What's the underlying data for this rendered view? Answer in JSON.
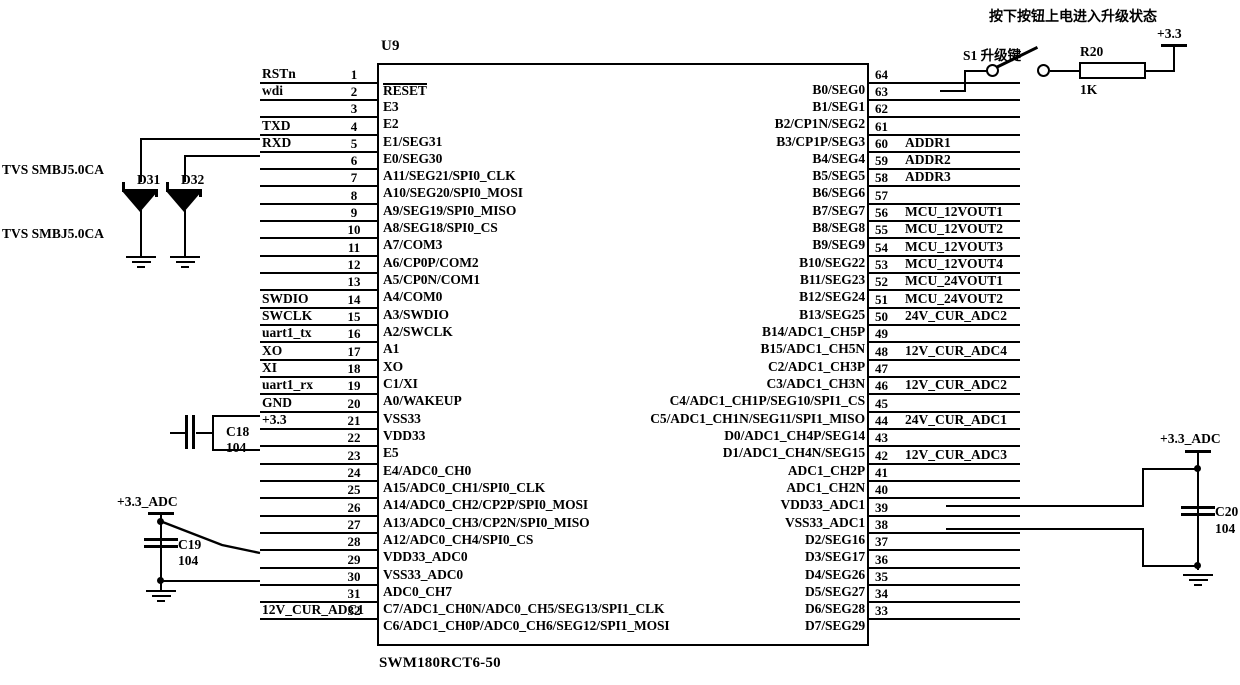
{
  "title_note": "按下按钮上电进入升级状态",
  "ic": {
    "ref": "U9",
    "part": "SWM180RCT6-50",
    "left_pins": [
      {
        "num": "1",
        "name": "RESET",
        "overline": true,
        "net": "RSTn"
      },
      {
        "num": "2",
        "name": "E3",
        "overline": false,
        "net": "wdi"
      },
      {
        "num": "3",
        "name": "E2",
        "overline": false,
        "net": ""
      },
      {
        "num": "4",
        "name": "E1/SEG31",
        "overline": false,
        "net": "TXD"
      },
      {
        "num": "5",
        "name": "E0/SEG30",
        "overline": false,
        "net": "RXD"
      },
      {
        "num": "6",
        "name": "A11/SEG21/SPI0_CLK",
        "overline": false,
        "net": ""
      },
      {
        "num": "7",
        "name": "A10/SEG20/SPI0_MOSI",
        "overline": false,
        "net": ""
      },
      {
        "num": "8",
        "name": "A9/SEG19/SPI0_MISO",
        "overline": false,
        "net": ""
      },
      {
        "num": "9",
        "name": "A8/SEG18/SPI0_CS",
        "overline": false,
        "net": ""
      },
      {
        "num": "10",
        "name": "A7/COM3",
        "overline": false,
        "net": ""
      },
      {
        "num": "11",
        "name": "A6/CP0P/COM2",
        "overline": false,
        "net": ""
      },
      {
        "num": "12",
        "name": "A5/CP0N/COM1",
        "overline": false,
        "net": ""
      },
      {
        "num": "13",
        "name": "A4/COM0",
        "overline": false,
        "net": ""
      },
      {
        "num": "14",
        "name": "A3/SWDIO",
        "overline": false,
        "net": "SWDIO"
      },
      {
        "num": "15",
        "name": "A2/SWCLK",
        "overline": false,
        "net": "SWCLK"
      },
      {
        "num": "16",
        "name": "A1",
        "overline": false,
        "net": "uart1_tx"
      },
      {
        "num": "17",
        "name": "XO",
        "overline": false,
        "net": "XO"
      },
      {
        "num": "18",
        "name": "C1/XI",
        "overline": false,
        "net": "XI"
      },
      {
        "num": "19",
        "name": "A0/WAKEUP",
        "overline": false,
        "net": "uart1_rx"
      },
      {
        "num": "20",
        "name": "VSS33",
        "overline": false,
        "net": "GND"
      },
      {
        "num": "21",
        "name": "VDD33",
        "overline": false,
        "net": "+3.3"
      },
      {
        "num": "22",
        "name": "E5",
        "overline": false,
        "net": ""
      },
      {
        "num": "23",
        "name": "E4/ADC0_CH0",
        "overline": false,
        "net": ""
      },
      {
        "num": "24",
        "name": "A15/ADC0_CH1/SPI0_CLK",
        "overline": false,
        "net": ""
      },
      {
        "num": "25",
        "name": "A14/ADC0_CH2/CP2P/SPI0_MOSI",
        "overline": false,
        "net": ""
      },
      {
        "num": "26",
        "name": "A13/ADC0_CH3/CP2N/SPI0_MISO",
        "overline": false,
        "net": ""
      },
      {
        "num": "27",
        "name": "A12/ADC0_CH4/SPI0_CS",
        "overline": false,
        "net": ""
      },
      {
        "num": "28",
        "name": "VDD33_ADC0",
        "overline": false,
        "net": ""
      },
      {
        "num": "29",
        "name": "VSS33_ADC0",
        "overline": false,
        "net": ""
      },
      {
        "num": "30",
        "name": "ADC0_CH7",
        "overline": false,
        "net": ""
      },
      {
        "num": "31",
        "name": "C7/ADC1_CH0N/ADC0_CH5/SEG13/SPI1_CLK",
        "overline": false,
        "net": ""
      },
      {
        "num": "32",
        "name": "C6/ADC1_CH0P/ADC0_CH6/SEG12/SPI1_MOSI",
        "overline": false,
        "net": "12V_CUR_ADC1"
      }
    ],
    "right_pins": [
      {
        "num": "64",
        "name": "B0/SEG0",
        "net": ""
      },
      {
        "num": "63",
        "name": "B1/SEG1",
        "net": ""
      },
      {
        "num": "62",
        "name": "B2/CP1N/SEG2",
        "net": ""
      },
      {
        "num": "61",
        "name": "B3/CP1P/SEG3",
        "net": ""
      },
      {
        "num": "60",
        "name": "B4/SEG4",
        "net": "ADDR1"
      },
      {
        "num": "59",
        "name": "B5/SEG5",
        "net": "ADDR2"
      },
      {
        "num": "58",
        "name": "B6/SEG6",
        "net": "ADDR3"
      },
      {
        "num": "57",
        "name": "B7/SEG7",
        "net": ""
      },
      {
        "num": "56",
        "name": "B8/SEG8",
        "net": "MCU_12VOUT1"
      },
      {
        "num": "55",
        "name": "B9/SEG9",
        "net": "MCU_12VOUT2"
      },
      {
        "num": "54",
        "name": "B10/SEG22",
        "net": "MCU_12VOUT3"
      },
      {
        "num": "53",
        "name": "B11/SEG23",
        "net": "MCU_12VOUT4"
      },
      {
        "num": "52",
        "name": "B12/SEG24",
        "net": "MCU_24VOUT1"
      },
      {
        "num": "51",
        "name": "B13/SEG25",
        "net": "MCU_24VOUT2"
      },
      {
        "num": "50",
        "name": "B14/ADC1_CH5P",
        "net": "24V_CUR_ADC2"
      },
      {
        "num": "49",
        "name": "B15/ADC1_CH5N",
        "net": ""
      },
      {
        "num": "48",
        "name": "C2/ADC1_CH3P",
        "net": "12V_CUR_ADC4"
      },
      {
        "num": "47",
        "name": "C3/ADC1_CH3N",
        "net": ""
      },
      {
        "num": "46",
        "name": "C4/ADC1_CH1P/SEG10/SPI1_CS",
        "net": "12V_CUR_ADC2"
      },
      {
        "num": "45",
        "name": "C5/ADC1_CH1N/SEG11/SPI1_MISO",
        "net": ""
      },
      {
        "num": "44",
        "name": "D0/ADC1_CH4P/SEG14",
        "net": "24V_CUR_ADC1"
      },
      {
        "num": "43",
        "name": "D1/ADC1_CH4N/SEG15",
        "net": ""
      },
      {
        "num": "42",
        "name": "ADC1_CH2P",
        "net": "12V_CUR_ADC3"
      },
      {
        "num": "41",
        "name": "ADC1_CH2N",
        "net": ""
      },
      {
        "num": "40",
        "name": "VDD33_ADC1",
        "net": ""
      },
      {
        "num": "39",
        "name": "VSS33_ADC1",
        "net": ""
      },
      {
        "num": "38",
        "name": "D2/SEG16",
        "net": ""
      },
      {
        "num": "37",
        "name": "D3/SEG17",
        "net": ""
      },
      {
        "num": "36",
        "name": "D4/SEG26",
        "net": ""
      },
      {
        "num": "35",
        "name": "D5/SEG27",
        "net": ""
      },
      {
        "num": "34",
        "name": "D6/SEG28",
        "net": ""
      },
      {
        "num": "33",
        "name": "D7/SEG29",
        "net": ""
      }
    ]
  },
  "components": {
    "d31": {
      "ref": "D31",
      "value": "TVS SMBJ5.0CA"
    },
    "d32": {
      "ref": "D32",
      "value": "TVS SMBJ5.0CA"
    },
    "c18": {
      "ref": "C18",
      "value": "104"
    },
    "c19": {
      "ref": "C19",
      "value": "104"
    },
    "c20": {
      "ref": "C20",
      "value": "104"
    },
    "r20": {
      "ref": "R20",
      "value": "1K"
    },
    "s1": {
      "ref": "S1 升级键"
    }
  },
  "power": {
    "vcc33_top": "+3.3",
    "vcc33_adc_left": "+3.3_ADC",
    "vcc33_adc_right": "+3.3_ADC"
  }
}
